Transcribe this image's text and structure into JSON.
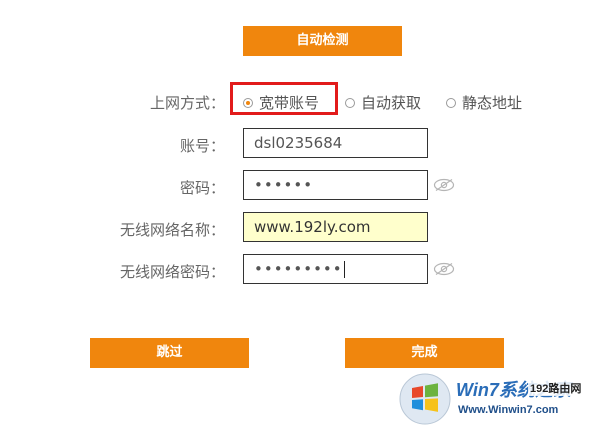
{
  "top_button": {
    "label": "自动检测"
  },
  "form": {
    "connection_type": {
      "label": "上网方式：",
      "options": [
        "宽带账号",
        "自动获取",
        "静态地址"
      ],
      "selected_index": 0
    },
    "account": {
      "label": "账号：",
      "value": "dsl0235684"
    },
    "password": {
      "label": "密码：",
      "value": "••••••"
    },
    "wifi_name": {
      "label": "无线网络名称：",
      "value": "www.192ly.com"
    },
    "wifi_password": {
      "label": "无线网络密码：",
      "value": "•••••••••"
    }
  },
  "footer": {
    "skip_label": "跳过",
    "finish_label": "完成"
  },
  "watermark": {
    "brand": "Win7系统之家",
    "url": "Www.Winwin7.com",
    "site_badge": "192路由网"
  },
  "colors": {
    "accent": "#f0860d",
    "highlight_border": "#e21b1b",
    "wifi_field_bg": "#ffffcc"
  }
}
